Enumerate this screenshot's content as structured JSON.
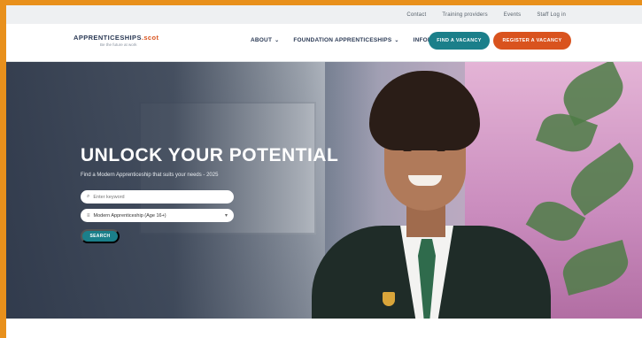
{
  "utility_nav": [
    "Contact",
    "Training providers",
    "Events",
    "Staff Log in"
  ],
  "brand": {
    "name": "APPRENTICESHIPS",
    "domain": ".scot",
    "tagline": "Be the future at work"
  },
  "main_nav": [
    {
      "label": "ABOUT"
    },
    {
      "label": "FOUNDATION APPRENTICESHIPS"
    },
    {
      "label": "INFORMATION"
    }
  ],
  "header_buttons": {
    "find": "FIND A VACANCY",
    "register": "REGISTER A VACANCY"
  },
  "hero": {
    "title": "UNLOCK YOUR POTENTIAL",
    "subtitle": "Find a Modern Apprenticeship that suits your needs - 2025",
    "search_placeholder": "Enter keyword",
    "select_value": "Modern Apprenticeship (Age 16+)",
    "search_button": "SEARCH"
  },
  "colors": {
    "accent_orange": "#d9531e",
    "accent_teal": "#1b7f8a",
    "frame": "#e8901c"
  }
}
